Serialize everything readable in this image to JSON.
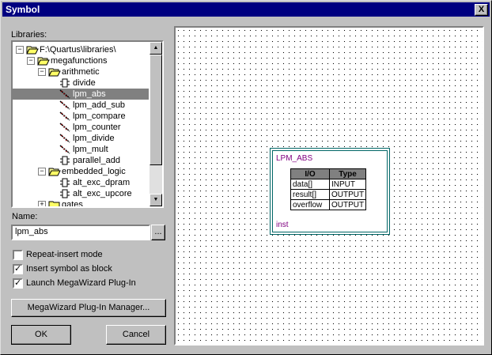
{
  "window": {
    "title": "Symbol",
    "close_glyph": "X"
  },
  "libraries": {
    "label": "Libraries:",
    "tree": [
      {
        "label": "F:\\Quartus\\libraries\\",
        "level": 0,
        "expander": "−",
        "icon": "open-folder-icon"
      },
      {
        "label": "megafunctions",
        "level": 1,
        "expander": "−",
        "icon": "open-folder-icon"
      },
      {
        "label": "arithmetic",
        "level": 2,
        "expander": "−",
        "icon": "open-folder-icon"
      },
      {
        "label": "divide",
        "level": 3,
        "icon": "symbol-icon"
      },
      {
        "label": "lpm_abs",
        "level": 3,
        "icon": "wizard-icon",
        "selected": true
      },
      {
        "label": "lpm_add_sub",
        "level": 3,
        "icon": "wizard-icon"
      },
      {
        "label": "lpm_compare",
        "level": 3,
        "icon": "wizard-icon"
      },
      {
        "label": "lpm_counter",
        "level": 3,
        "icon": "wizard-icon"
      },
      {
        "label": "lpm_divide",
        "level": 3,
        "icon": "wizard-icon"
      },
      {
        "label": "lpm_mult",
        "level": 3,
        "icon": "wizard-icon"
      },
      {
        "label": "parallel_add",
        "level": 3,
        "icon": "symbol-icon"
      },
      {
        "label": "embedded_logic",
        "level": 2,
        "expander": "−",
        "icon": "open-folder-icon"
      },
      {
        "label": "alt_exc_dpram",
        "level": 3,
        "icon": "symbol-icon"
      },
      {
        "label": "alt_exc_upcore",
        "level": 3,
        "icon": "symbol-icon"
      },
      {
        "label": "gates",
        "level": 2,
        "expander": "+",
        "icon": "closed-folder-icon"
      }
    ]
  },
  "name": {
    "label": "Name:",
    "value": "lpm_abs",
    "browse_label": "..."
  },
  "options": [
    {
      "label": "Repeat-insert mode",
      "checked": false
    },
    {
      "label": "Insert symbol as block",
      "checked": true
    },
    {
      "label": "Launch MegaWizard Plug-In",
      "checked": true
    }
  ],
  "buttons": {
    "megawizard": "MegaWizard Plug-In Manager...",
    "ok": "OK",
    "cancel": "Cancel"
  },
  "symbol_preview": {
    "name": "LPM_ABS",
    "instance": "inst",
    "headers": [
      "I/O",
      "Type"
    ],
    "ports": [
      [
        "data[]",
        "INPUT"
      ],
      [
        "result[]",
        "OUTPUT"
      ],
      [
        "overflow",
        "OUTPUT"
      ]
    ]
  }
}
